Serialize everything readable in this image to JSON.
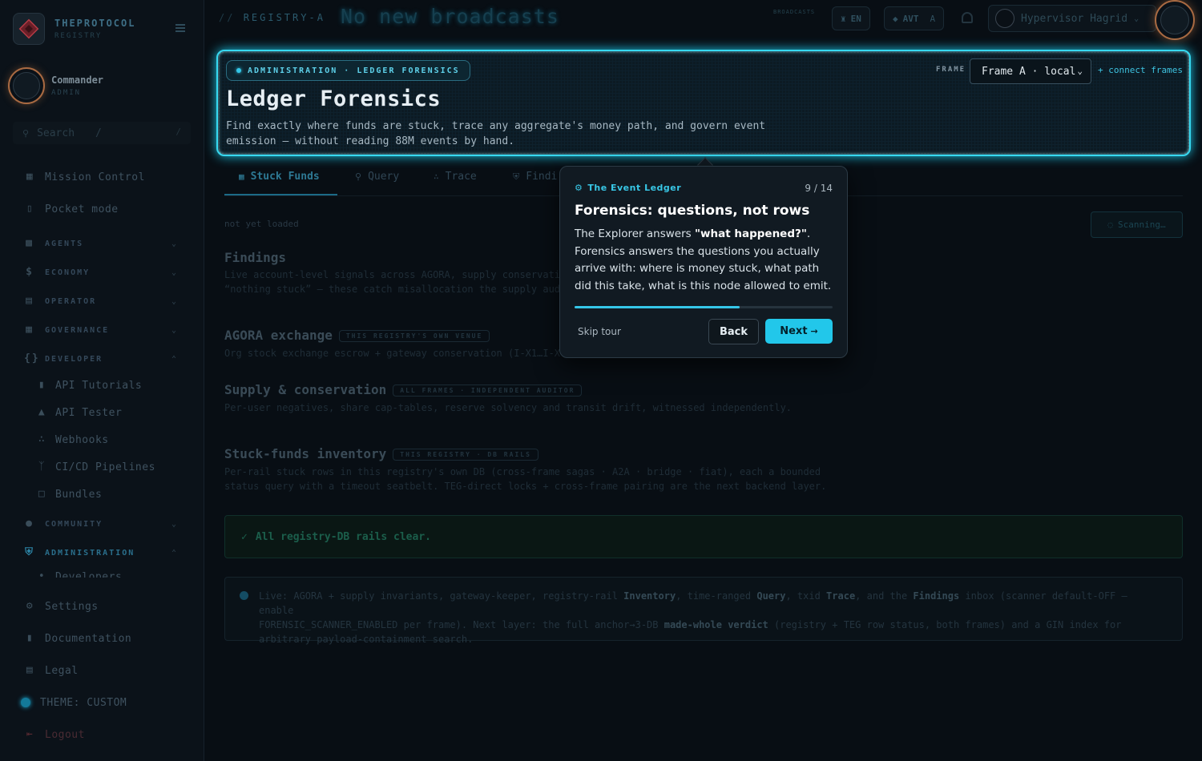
{
  "sidebar": {
    "brand_name": "THEPROTOCOL",
    "brand_sub": "REGISTRY",
    "user_name": "Commander",
    "user_role": "ADMIN",
    "search_placeholder": "Search",
    "search_key": "/",
    "items": [
      {
        "label": "Mission Control",
        "icon": "grid-icon"
      },
      {
        "label": "Pocket mode",
        "icon": "phone-icon"
      }
    ],
    "groups": [
      {
        "label": "AGENTS",
        "icon": "robot-icon"
      },
      {
        "label": "ECONOMY",
        "icon": "dollar-icon"
      },
      {
        "label": "OPERATOR",
        "icon": "server-icon"
      },
      {
        "label": "GOVERNANCE",
        "icon": "table-icon"
      },
      {
        "label": "DEVELOPER",
        "icon": "braces-icon"
      }
    ],
    "developer_items": [
      {
        "label": "API Tutorials",
        "icon": "file-icon"
      },
      {
        "label": "API Tester",
        "icon": "flask-icon"
      },
      {
        "label": "Webhooks",
        "icon": "webhook-icon"
      },
      {
        "label": "CI/CD Pipelines",
        "icon": "branch-icon"
      },
      {
        "label": "Bundles",
        "icon": "box-icon"
      }
    ],
    "community_label": "COMMUNITY",
    "administration_label": "ADMINISTRATION",
    "admin_partial": "Developers",
    "bottom_items": [
      {
        "label": "Settings",
        "icon": "gear-icon"
      },
      {
        "label": "Documentation",
        "icon": "book-icon"
      },
      {
        "label": "Legal",
        "icon": "legal-icon"
      }
    ],
    "theme_label": "THEME: CUSTOM",
    "logout_label": "Logout"
  },
  "topbar": {
    "crumb": "REGISTRY-A",
    "broadcast": "No new broadcasts",
    "broadcast_label": "BROADCASTS",
    "lang": "EN",
    "token": "AVT",
    "token_sub": "A",
    "account": "Hypervisor Hagrid"
  },
  "hero": {
    "chip": "ADMINISTRATION · LEDGER FORENSICS",
    "title": "Ledger Forensics",
    "desc": "Find exactly where funds are stuck, trace any aggregate's money path, and govern event emission — without reading 88M events by hand.",
    "frame_label": "FRAME",
    "frame_value": "Frame A · local",
    "connect": "+ connect frames"
  },
  "tabs": [
    {
      "label": "Stuck Funds",
      "icon": "table-icon"
    },
    {
      "label": "Query",
      "icon": "search-icon"
    },
    {
      "label": "Trace",
      "icon": "route-icon"
    },
    {
      "label": "Findi",
      "icon": "shield-icon"
    }
  ],
  "content": {
    "not_loaded": "not yet loaded",
    "scanning": "Scanning…",
    "findings_title": "Findings",
    "findings_desc_1": "Live account-level signals across AGORA, supply conservati",
    "findings_desc_2": "“nothing stuck” — these catch misallocation the supply aud",
    "agora_title": "AGORA exchange",
    "agora_badge": "THIS REGISTRY'S OWN VENUE",
    "agora_desc": "Org stock exchange escrow + gateway conservation (I-X1…I-X",
    "supply_title": "Supply & conservation",
    "supply_badge": "ALL FRAMES · INDEPENDENT AUDITOR",
    "supply_desc": "Per-user negatives, share cap-tables, reserve solvency and transit drift, witnessed independently.",
    "stuck_title": "Stuck-funds inventory",
    "stuck_badge": "THIS REGISTRY · DB RAILS",
    "stuck_desc_1": "Per-rail stuck rows in this registry's own DB (cross-frame sagas · A2A · bridge · fiat), each a bounded",
    "stuck_desc_2": "status query with a timeout seatbelt. TEG-direct locks + cross-frame pairing are the next backend layer.",
    "clear": "All registry-DB rails clear.",
    "info_1a": "Live: AGORA + supply invariants, gateway-keeper, registry-rail ",
    "info_1b": "Inventory",
    "info_1c": ", time-ranged ",
    "info_1d": "Query",
    "info_1e": ", txid ",
    "info_1f": "Trace",
    "info_1g": ", and the ",
    "info_1h": "Findings",
    "info_1i": " inbox (scanner default-OFF — enable",
    "info_2a": "FORENSIC_SCANNER_ENABLED per frame). Next layer: the full anchor→3-DB ",
    "info_2b": "made-whole verdict",
    "info_2c": " (registry + TEG row status, both frames) and a GIN index for",
    "info_3": "arbitrary payload-containment search."
  },
  "tour": {
    "kicker": "The Event Ledger",
    "count": "9 / 14",
    "progress": 0.64,
    "title": "Forensics: questions, not rows",
    "body_1": "The Explorer answers ",
    "body_bold": "\"what happened?\"",
    "body_2": ". Forensics answers the questions you actually arrive with: where is money stuck, what path did this take, what is this node allowed to emit.",
    "skip": "Skip tour",
    "back": "Back",
    "next": "Next",
    "next_arrow": "→"
  },
  "colors": {
    "accent": "#22c7ea",
    "glow": "#37d9f0",
    "avatar_ring": "#a96a42"
  }
}
